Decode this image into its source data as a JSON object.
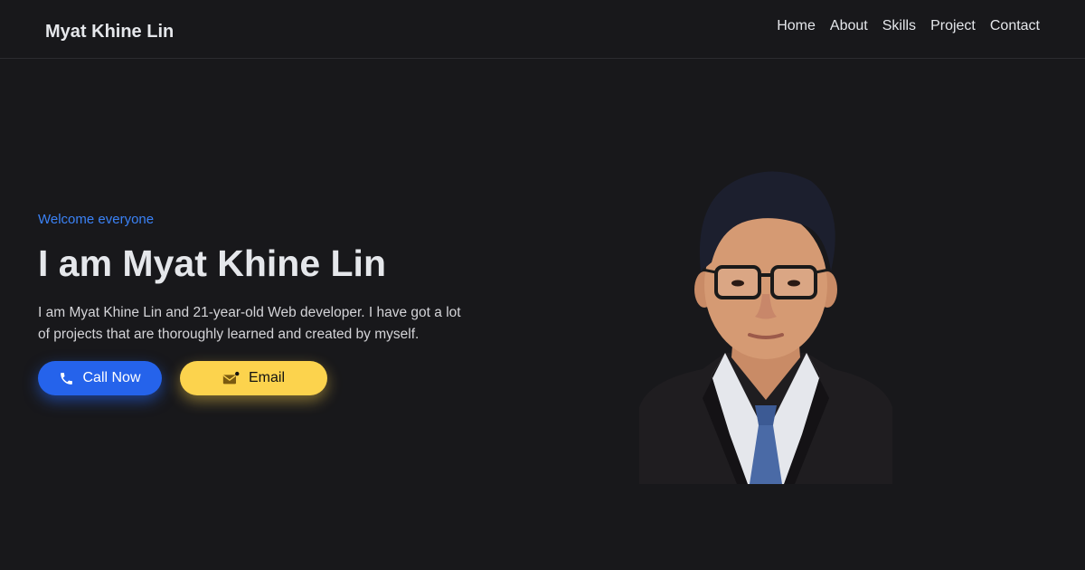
{
  "header": {
    "brand": "Myat Khine Lin",
    "nav": [
      {
        "label": "Home"
      },
      {
        "label": "About"
      },
      {
        "label": "Skills"
      },
      {
        "label": "Project"
      },
      {
        "label": "Contact"
      }
    ]
  },
  "hero": {
    "eyebrow": "Welcome everyone",
    "headline": "I am Myat Khine Lin",
    "intro": "I am Myat Khine Lin and 21-year-old Web developer. I have got a lot of projects that are thoroughly learned and created by myself.",
    "buttons": {
      "call": {
        "label": "Call Now",
        "icon": "phone-icon"
      },
      "email": {
        "label": "Email",
        "icon": "mail-icon"
      }
    }
  },
  "colors": {
    "background": "#18181b",
    "accent": "#3b82f6",
    "call_button": "#2563eb",
    "email_button": "#fcd34d"
  }
}
